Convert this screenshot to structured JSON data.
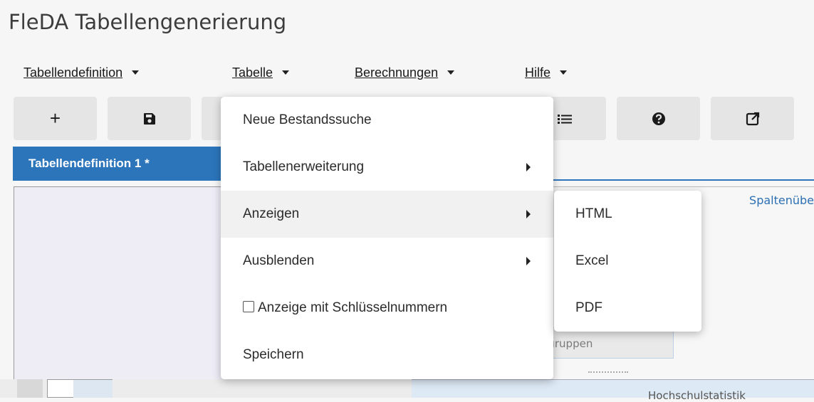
{
  "app": {
    "title": "FleDA Tabellengenerierung"
  },
  "menubar": {
    "items": [
      {
        "label": "Tabellendefinition"
      },
      {
        "label": "Tabelle"
      },
      {
        "label": "Berechnungen"
      },
      {
        "label": "Hilfe"
      }
    ]
  },
  "toolbar": {
    "add_label": "+",
    "buttons": [
      {
        "icon": "plus-icon"
      },
      {
        "icon": "save-icon"
      },
      {
        "icon": "list-icon"
      },
      {
        "icon": "help-icon"
      },
      {
        "icon": "external-link-icon"
      }
    ]
  },
  "tabs": {
    "active": "Tabellendefinition 1 *"
  },
  "panels": {
    "column_header": "Spaltenübe",
    "group_chip": "ungsgruppen",
    "bottom_text": "Hochschulstatistik"
  },
  "dropdown": {
    "items": [
      {
        "label": "Neue Bestandssuche",
        "submenu": false
      },
      {
        "label": "Tabellenerweiterung",
        "submenu": true
      },
      {
        "label": "Anzeigen",
        "submenu": true,
        "hovered": true
      },
      {
        "label": "Ausblenden",
        "submenu": true
      },
      {
        "label": "Anzeige mit Schlüsselnummern",
        "checkbox": true,
        "checked": false
      },
      {
        "label": "Speichern",
        "submenu": false
      }
    ]
  },
  "submenu": {
    "items": [
      {
        "label": "HTML"
      },
      {
        "label": "Excel"
      },
      {
        "label": "PDF"
      }
    ]
  }
}
